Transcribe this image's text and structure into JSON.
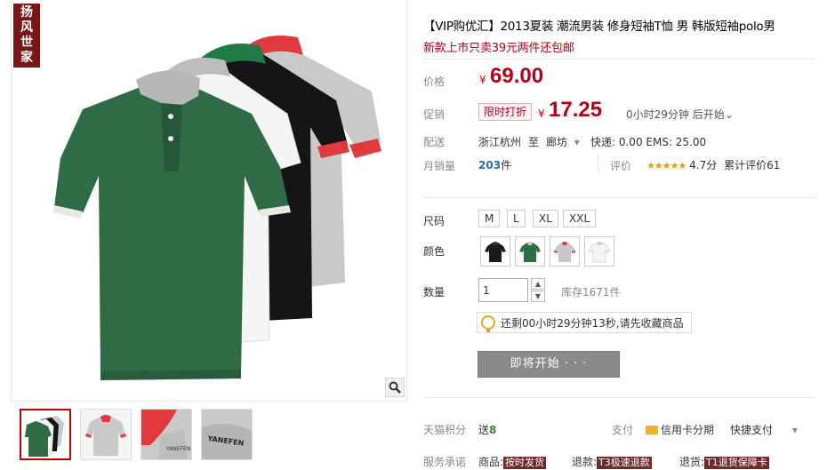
{
  "store": {
    "seal_chars": [
      "扬",
      "风",
      "世",
      "家"
    ]
  },
  "product": {
    "title": "【VIP购优汇】2013夏装 潮流男装 修身短袖T恤 男 韩版短袖polo男",
    "subtitle": "新款上市只卖39元两件还包邮",
    "image_text": "YANEFEN"
  },
  "price": {
    "label": "价格",
    "currency": "¥",
    "value": "69.00"
  },
  "promo": {
    "label": "促销",
    "tag": "限时打折",
    "currency": "¥",
    "value": "17.25",
    "countdown": "0小时29分钟 后开始",
    "dropdown_glyph": "⌄"
  },
  "delivery": {
    "label": "配送",
    "from": "浙江杭州",
    "to_word": "至",
    "dest": "廊坊",
    "dest_arrow": "▾",
    "fee": "快递: 0.00 EMS: 25.00"
  },
  "sales": {
    "label": "月销量",
    "count": "203",
    "unit": "件",
    "review_label": "评价",
    "stars": "★★★★★",
    "rating": "4.7分",
    "cumulative": "累计评价61"
  },
  "size": {
    "label": "尺码",
    "options": [
      "M",
      "L",
      "XL",
      "XXL"
    ]
  },
  "color": {
    "label": "颜色",
    "swatches": [
      {
        "name": "black",
        "shirt": "#1a1a1a",
        "collar": "#333333"
      },
      {
        "name": "green",
        "shirt": "#2e6e46",
        "collar": "#cccccc"
      },
      {
        "name": "grey-red",
        "shirt": "#c8c8c8",
        "collar": "#e23a3a"
      },
      {
        "name": "white",
        "shirt": "#f4f4f4",
        "collar": "#cfcfcf"
      }
    ]
  },
  "quantity": {
    "label": "数量",
    "value": "1",
    "up": "▲",
    "down": "▼",
    "stock": "库存1671件"
  },
  "tip": {
    "text": "还剩00小时29分钟13秒,请先收藏商品"
  },
  "action": {
    "button": "即将开始 · · ·"
  },
  "points": {
    "label": "天猫积分",
    "send_word": "送",
    "value": "8",
    "pay_label": "支付",
    "credit": "信用卡分期",
    "quick": "快捷支付",
    "arrow": "▾"
  },
  "service": {
    "label": "服务承诺",
    "goods_label": "商品:",
    "goods_badge": "按时发货",
    "return_label": "退款:",
    "return_badge": "T3极速退款",
    "exchange_label": "退货:",
    "exchange_badge": "T1退货保障卡"
  },
  "colors": {
    "accent_red": "#b5001a",
    "link_blue": "#2b6cb2",
    "button_grey": "#8a8a8a"
  },
  "icons": [
    "magnifier-icon",
    "lightbulb-icon",
    "credit-card-icon"
  ]
}
